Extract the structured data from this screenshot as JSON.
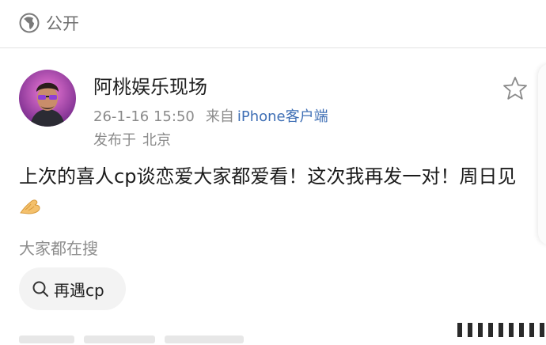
{
  "header": {
    "visibility_label": "公开",
    "visibility_icon": "globe-icon"
  },
  "post": {
    "author_name": "阿桃娱乐现场",
    "timestamp": "26-1-16 15:50",
    "source_prefix": "来自",
    "source_app": "iPhone客户端",
    "location_prefix": "发布于",
    "location": "北京",
    "text": "上次的喜人cp谈恋爱大家都爱看！这次我再发一对！周日见",
    "emoji": "pinched-fingers-emoji",
    "favorite_icon": "star-outline-icon"
  },
  "search": {
    "header": "大家都在搜",
    "chip_label": "再遇cp",
    "chip_icon": "search-icon"
  },
  "colors": {
    "link": "#3f6fb5",
    "muted": "#8a8a8a",
    "chip_bg": "#f3f3f3"
  }
}
